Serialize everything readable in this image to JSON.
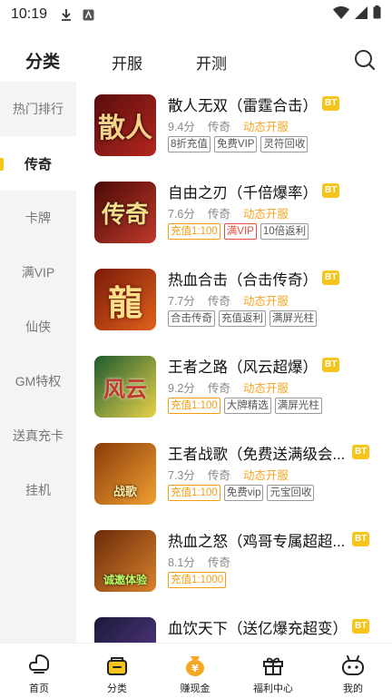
{
  "status_bar": {
    "time": "10:19"
  },
  "top_tabs": [
    {
      "label": "分类",
      "active": true
    },
    {
      "label": "开服",
      "active": false
    },
    {
      "label": "开测",
      "active": false
    }
  ],
  "sidebar": {
    "items": [
      {
        "label": "热门排行",
        "active": false
      },
      {
        "label": "传奇",
        "active": true
      },
      {
        "label": "卡牌",
        "active": false
      },
      {
        "label": "满VIP",
        "active": false
      },
      {
        "label": "仙侠",
        "active": false
      },
      {
        "label": "GM特权",
        "active": false
      },
      {
        "label": "送真充卡",
        "active": false
      },
      {
        "label": "挂机",
        "active": false
      }
    ]
  },
  "games": [
    {
      "name": "散人无双（雷霆合击）",
      "badge": "BT",
      "rating": "9.4分",
      "genre": "传奇",
      "status": "动态开服",
      "tags": [
        {
          "text": "8折充值",
          "style": "gray"
        },
        {
          "text": "免费VIP",
          "style": "gray"
        },
        {
          "text": "灵符回收",
          "style": "gray"
        }
      ],
      "thumb_text": "散人",
      "thumb_colors": [
        "#5a0d0d",
        "#b3261e"
      ]
    },
    {
      "name": "自由之刃（千倍爆率）",
      "badge": "BT",
      "rating": "7.6分",
      "genre": "传奇",
      "status": "动态开服",
      "tags": [
        {
          "text": "充值1:100",
          "style": "orange"
        },
        {
          "text": "满VIP",
          "style": "red"
        },
        {
          "text": "10倍返利",
          "style": "gray"
        }
      ],
      "thumb_text": "传奇",
      "thumb_colors": [
        "#4a0a05",
        "#c0392b"
      ]
    },
    {
      "name": "热血合击（合击传奇）",
      "badge": "BT",
      "rating": "7.7分",
      "genre": "传奇",
      "status": "动态开服",
      "tags": [
        {
          "text": "合击传奇",
          "style": "gray"
        },
        {
          "text": "充值返利",
          "style": "gray"
        },
        {
          "text": "满屏光柱",
          "style": "gray"
        }
      ],
      "thumb_text": "龍",
      "thumb_colors": [
        "#7a1a08",
        "#e0621c"
      ]
    },
    {
      "name": "王者之路（风云超爆）",
      "badge": "BT",
      "rating": "9.2分",
      "genre": "传奇",
      "status": "动态开服",
      "tags": [
        {
          "text": "充值1:100",
          "style": "orange"
        },
        {
          "text": "大牌精选",
          "style": "gray"
        },
        {
          "text": "满屏光柱",
          "style": "gray"
        }
      ],
      "thumb_text": "风云",
      "thumb_colors": [
        "#1d5a2e",
        "#e8d24a"
      ]
    },
    {
      "name": "王者战歌（免费送满级会...",
      "badge": "BT",
      "rating": "7.3分",
      "genre": "传奇",
      "status": "动态开服",
      "tags": [
        {
          "text": "充值1:100",
          "style": "orange"
        },
        {
          "text": "免费vip",
          "style": "gray"
        },
        {
          "text": "元宝回收",
          "style": "gray"
        }
      ],
      "thumb_text": "战歌",
      "thumb_colors": [
        "#8a3b0a",
        "#f0a030"
      ]
    },
    {
      "name": "热血之怒（鸡哥专属超超...",
      "badge": "BT",
      "rating": "8.1分",
      "genre": "传奇",
      "status": "",
      "tags": [
        {
          "text": "充值1:1000",
          "style": "orange"
        }
      ],
      "thumb_text": "诚邀体验",
      "thumb_colors": [
        "#6b2a0a",
        "#d9822b"
      ]
    },
    {
      "name": "血饮天下（送亿爆充超变）",
      "badge": "BT",
      "rating": "",
      "genre": "",
      "status": "",
      "tags": [],
      "thumb_text": "",
      "thumb_colors": [
        "#1a1a3a",
        "#5a3a8a"
      ]
    }
  ],
  "bottom_nav": [
    {
      "label": "首页",
      "icon": "home-icon"
    },
    {
      "label": "分类",
      "icon": "category-icon"
    },
    {
      "label": "赚现金",
      "icon": "money-icon"
    },
    {
      "label": "福利中心",
      "icon": "gift-icon"
    },
    {
      "label": "我的",
      "icon": "profile-icon"
    }
  ],
  "colors": {
    "accent": "#f5c51b",
    "orange": "#f5a623",
    "tag_orange": "#f39c12",
    "tag_red": "#e74c3c"
  }
}
